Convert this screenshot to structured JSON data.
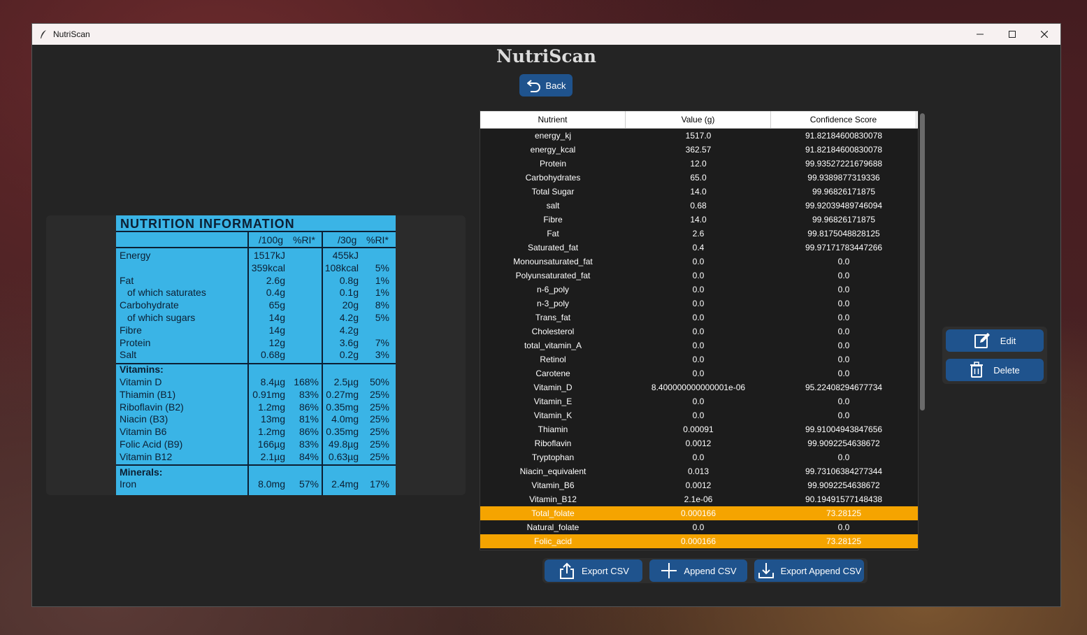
{
  "window": {
    "title": "NutriScan"
  },
  "app": {
    "heading": "NutriScan",
    "back_label": "Back"
  },
  "table": {
    "columns": [
      "Nutrient",
      "Value (g)",
      "Confidence Score"
    ],
    "rows": [
      {
        "nutrient": "energy_kj",
        "value": "1517.0",
        "confidence": "91.82184600830078",
        "highlighted": false
      },
      {
        "nutrient": "energy_kcal",
        "value": "362.57",
        "confidence": "91.82184600830078",
        "highlighted": false
      },
      {
        "nutrient": "Protein",
        "value": "12.0",
        "confidence": "99.93527221679688",
        "highlighted": false
      },
      {
        "nutrient": "Carbohydrates",
        "value": "65.0",
        "confidence": "99.9389877319336",
        "highlighted": false
      },
      {
        "nutrient": "Total Sugar",
        "value": "14.0",
        "confidence": "99.96826171875",
        "highlighted": false
      },
      {
        "nutrient": "salt",
        "value": "0.68",
        "confidence": "99.92039489746094",
        "highlighted": false
      },
      {
        "nutrient": "Fibre",
        "value": "14.0",
        "confidence": "99.96826171875",
        "highlighted": false
      },
      {
        "nutrient": "Fat",
        "value": "2.6",
        "confidence": "99.8175048828125",
        "highlighted": false
      },
      {
        "nutrient": "Saturated_fat",
        "value": "0.4",
        "confidence": "99.97171783447266",
        "highlighted": false
      },
      {
        "nutrient": "Monounsaturated_fat",
        "value": "0.0",
        "confidence": "0.0",
        "highlighted": false
      },
      {
        "nutrient": "Polyunsaturated_fat",
        "value": "0.0",
        "confidence": "0.0",
        "highlighted": false
      },
      {
        "nutrient": "n-6_poly",
        "value": "0.0",
        "confidence": "0.0",
        "highlighted": false
      },
      {
        "nutrient": "n-3_poly",
        "value": "0.0",
        "confidence": "0.0",
        "highlighted": false
      },
      {
        "nutrient": "Trans_fat",
        "value": "0.0",
        "confidence": "0.0",
        "highlighted": false
      },
      {
        "nutrient": "Cholesterol",
        "value": "0.0",
        "confidence": "0.0",
        "highlighted": false
      },
      {
        "nutrient": "total_vitamin_A",
        "value": "0.0",
        "confidence": "0.0",
        "highlighted": false
      },
      {
        "nutrient": "Retinol",
        "value": "0.0",
        "confidence": "0.0",
        "highlighted": false
      },
      {
        "nutrient": "Carotene",
        "value": "0.0",
        "confidence": "0.0",
        "highlighted": false
      },
      {
        "nutrient": "Vitamin_D",
        "value": "8.400000000000001e-06",
        "confidence": "95.22408294677734",
        "highlighted": false
      },
      {
        "nutrient": "Vitamin_E",
        "value": "0.0",
        "confidence": "0.0",
        "highlighted": false
      },
      {
        "nutrient": "Vitamin_K",
        "value": "0.0",
        "confidence": "0.0",
        "highlighted": false
      },
      {
        "nutrient": "Thiamin",
        "value": "0.00091",
        "confidence": "99.91004943847656",
        "highlighted": false
      },
      {
        "nutrient": "Riboflavin",
        "value": "0.0012",
        "confidence": "99.9092254638672",
        "highlighted": false
      },
      {
        "nutrient": "Tryptophan",
        "value": "0.0",
        "confidence": "0.0",
        "highlighted": false
      },
      {
        "nutrient": "Niacin_equivalent",
        "value": "0.013",
        "confidence": "99.73106384277344",
        "highlighted": false
      },
      {
        "nutrient": "Vitamin_B6",
        "value": "0.0012",
        "confidence": "99.9092254638672",
        "highlighted": false
      },
      {
        "nutrient": "Vitamin_B12",
        "value": "2.1e-06",
        "confidence": "90.19491577148438",
        "highlighted": false
      },
      {
        "nutrient": "Total_folate",
        "value": "0.000166",
        "confidence": "73.28125",
        "highlighted": true
      },
      {
        "nutrient": "Natural_folate",
        "value": "0.0",
        "confidence": "0.0",
        "highlighted": false
      },
      {
        "nutrient": "Folic_acid",
        "value": "0.000166",
        "confidence": "73.28125",
        "highlighted": true
      }
    ]
  },
  "actions": {
    "edit_label": "Edit",
    "delete_label": "Delete"
  },
  "export": {
    "export_csv": "Export CSV",
    "append_csv": "Append CSV",
    "export_append_csv": "Export Append CSV"
  },
  "nutrition_label": {
    "title": "NUTRITION INFORMATION",
    "headers": [
      "/100g",
      "%RI*",
      "/30g",
      "%RI*"
    ],
    "lines": [
      {
        "name": "Energy",
        "indent": false,
        "per100": "1517kJ",
        "ri100": "",
        "per30": "455kJ",
        "ri30": ""
      },
      {
        "name": "",
        "indent": false,
        "per100": "359kcal",
        "ri100": "",
        "per30": "108kcal",
        "ri30": "5%"
      },
      {
        "name": "Fat",
        "indent": false,
        "per100": "2.6g",
        "ri100": "",
        "per30": "0.8g",
        "ri30": "1%"
      },
      {
        "name": "of which saturates",
        "indent": true,
        "per100": "0.4g",
        "ri100": "",
        "per30": "0.1g",
        "ri30": "1%"
      },
      {
        "name": "Carbohydrate",
        "indent": false,
        "per100": "65g",
        "ri100": "",
        "per30": "20g",
        "ri30": "8%"
      },
      {
        "name": "of which sugars",
        "indent": true,
        "per100": "14g",
        "ri100": "",
        "per30": "4.2g",
        "ri30": "5%"
      },
      {
        "name": "Fibre",
        "indent": false,
        "per100": "14g",
        "ri100": "",
        "per30": "4.2g",
        "ri30": ""
      },
      {
        "name": "Protein",
        "indent": false,
        "per100": "12g",
        "ri100": "",
        "per30": "3.6g",
        "ri30": "7%"
      },
      {
        "name": "Salt",
        "indent": false,
        "per100": "0.68g",
        "ri100": "",
        "per30": "0.2g",
        "ri30": "3%"
      },
      {
        "name": "Vitamins:",
        "indent": false,
        "bold": true,
        "per100": "",
        "ri100": "",
        "per30": "",
        "ri30": ""
      },
      {
        "name": "Vitamin D",
        "indent": false,
        "per100": "8.4µg",
        "ri100": "168%",
        "per30": "2.5µg",
        "ri30": "50%"
      },
      {
        "name": "Thiamin (B1)",
        "indent": false,
        "per100": "0.91mg",
        "ri100": "83%",
        "per30": "0.27mg",
        "ri30": "25%"
      },
      {
        "name": "Riboflavin (B2)",
        "indent": false,
        "per100": "1.2mg",
        "ri100": "86%",
        "per30": "0.35mg",
        "ri30": "25%"
      },
      {
        "name": "Niacin (B3)",
        "indent": false,
        "per100": "13mg",
        "ri100": "81%",
        "per30": "4.0mg",
        "ri30": "25%"
      },
      {
        "name": "Vitamin B6",
        "indent": false,
        "per100": "1.2mg",
        "ri100": "86%",
        "per30": "0.35mg",
        "ri30": "25%"
      },
      {
        "name": "Folic Acid (B9)",
        "indent": false,
        "per100": "166µg",
        "ri100": "83%",
        "per30": "49.8µg",
        "ri30": "25%"
      },
      {
        "name": "Vitamin B12",
        "indent": false,
        "per100": "2.1µg",
        "ri100": "84%",
        "per30": "0.63µg",
        "ri30": "25%"
      },
      {
        "name": "Minerals:",
        "indent": false,
        "bold": true,
        "per100": "",
        "ri100": "",
        "per30": "",
        "ri30": ""
      },
      {
        "name": "Iron",
        "indent": false,
        "per100": "8.0mg",
        "ri100": "57%",
        "per30": "2.4mg",
        "ri30": "17%"
      }
    ]
  },
  "colors": {
    "accent": "#1f538d",
    "highlight": "#f5a400",
    "label_bg": "#3ab4e6",
    "window_bg": "#242424"
  },
  "icons": [
    "feather-icon",
    "minimize-icon",
    "maximize-icon",
    "close-icon",
    "undo-arrow-icon",
    "edit-icon",
    "trash-icon",
    "upload-icon",
    "plus-icon",
    "download-icon"
  ]
}
